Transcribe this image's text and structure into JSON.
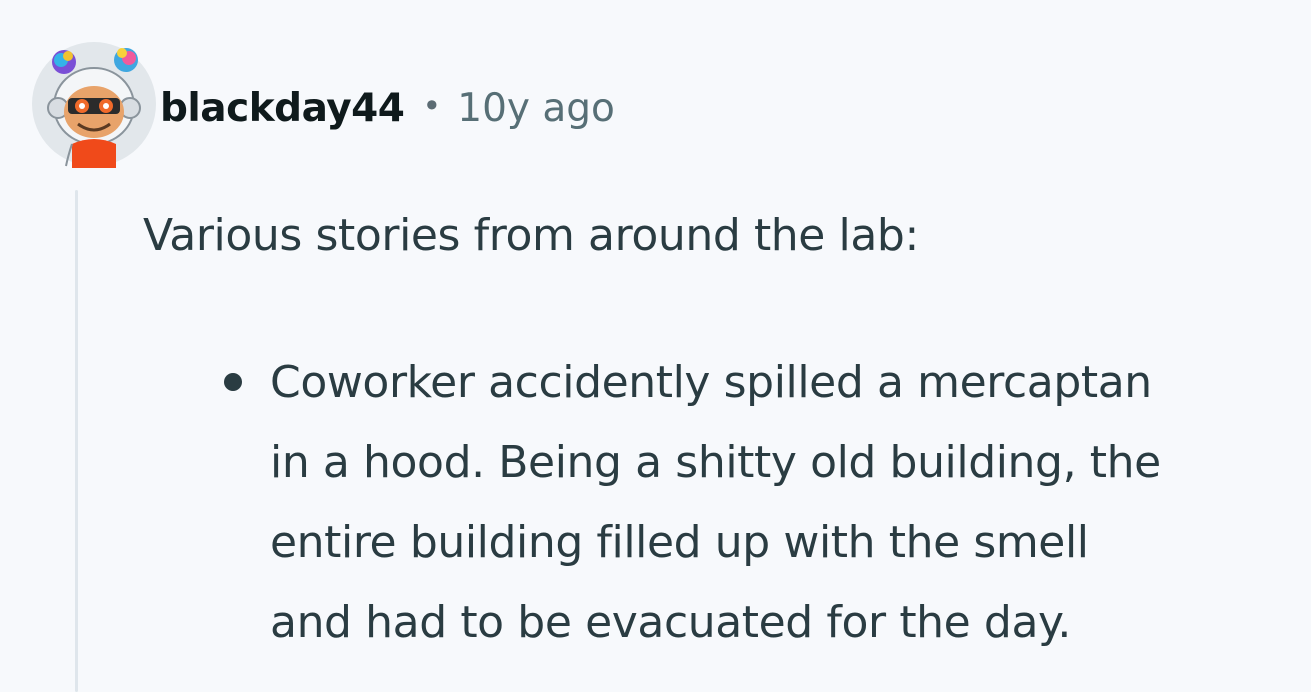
{
  "comment": {
    "author": {
      "username": "blackday44",
      "avatar_icon": "snoo-avatar-icon"
    },
    "separator": "•",
    "timestamp": "10y ago",
    "body": {
      "intro": "Various stories from around the lab:",
      "bullets": [
        {
          "lines": [
            "Coworker accidently spilled a mercaptan",
            "in a hood. Being a shitty old building, the",
            "entire building filled up with the smell",
            "and had to be evacuated for the day."
          ]
        }
      ]
    },
    "colors": {
      "background": "#f7f9fc",
      "username": "#0f1a1c",
      "timestamp": "#576f76",
      "body_text": "#2a3c42",
      "thread_line": "#dfe6ec"
    }
  }
}
